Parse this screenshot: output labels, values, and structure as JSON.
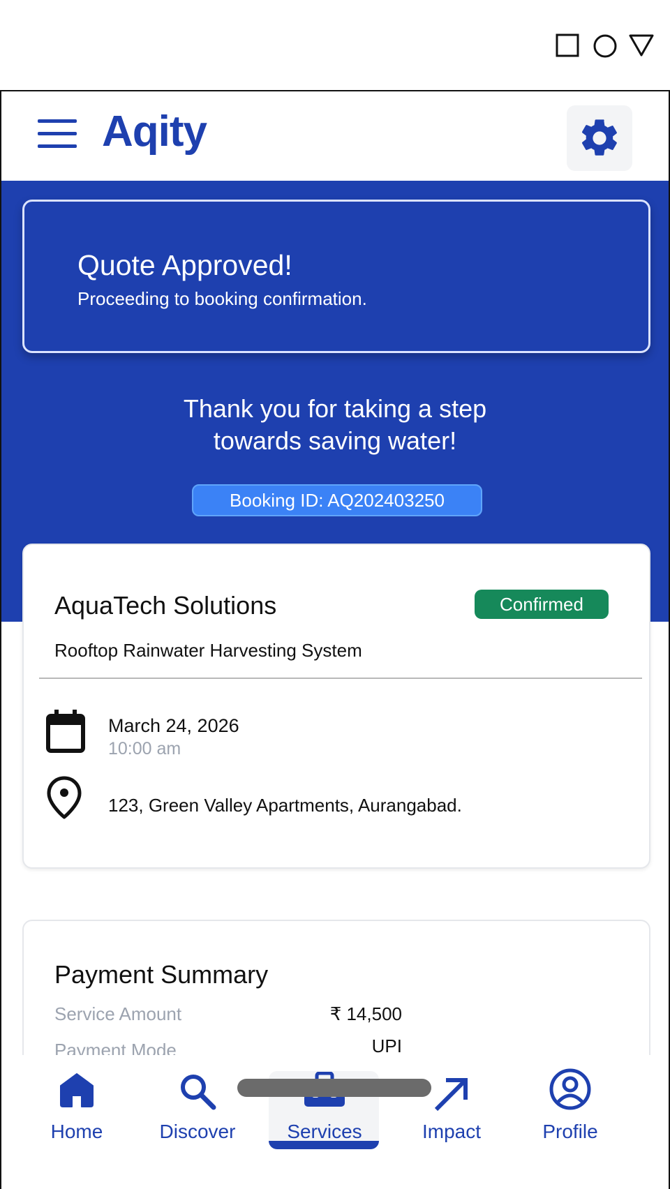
{
  "system": {
    "buttons": [
      "recents",
      "home",
      "back"
    ]
  },
  "app_bar": {
    "brand": "Aqity",
    "menu_icon": "hamburger-menu-icon",
    "settings_icon": "gear-icon"
  },
  "banner": {
    "title": "Quote Approved!",
    "subtitle": "Proceeding to booking confirmation."
  },
  "thanks": {
    "line1": "Thank you for taking a step",
    "line2": "towards saving water!"
  },
  "booking": {
    "id_label": "Booking ID: AQ202403250",
    "company": "AquaTech Solutions",
    "status": "Confirmed",
    "service": "Rooftop Rainwater Harvesting System",
    "date": "March 24, 2026",
    "time": "10:00 am",
    "address": "123, Green Valley Apartments, Aurangabad."
  },
  "payment": {
    "title": "Payment Summary",
    "rows": [
      {
        "label": "Service Amount",
        "value": "₹ 14,500"
      },
      {
        "label": "Payment Mode",
        "value": "UPI"
      }
    ]
  },
  "nav": {
    "items": [
      {
        "label": "Home",
        "icon": "home-icon"
      },
      {
        "label": "Discover",
        "icon": "search-icon"
      },
      {
        "label": "Services",
        "icon": "toolbox-icon"
      },
      {
        "label": "Impact",
        "icon": "arrow-up-right-icon"
      },
      {
        "label": "Profile",
        "icon": "profile-icon"
      }
    ],
    "active": "Services"
  },
  "colors": {
    "primary": "#1e40af",
    "badge_confirmed": "#16895a",
    "booking_chip": "#3b82f6",
    "muted_text": "#9ca3af"
  }
}
